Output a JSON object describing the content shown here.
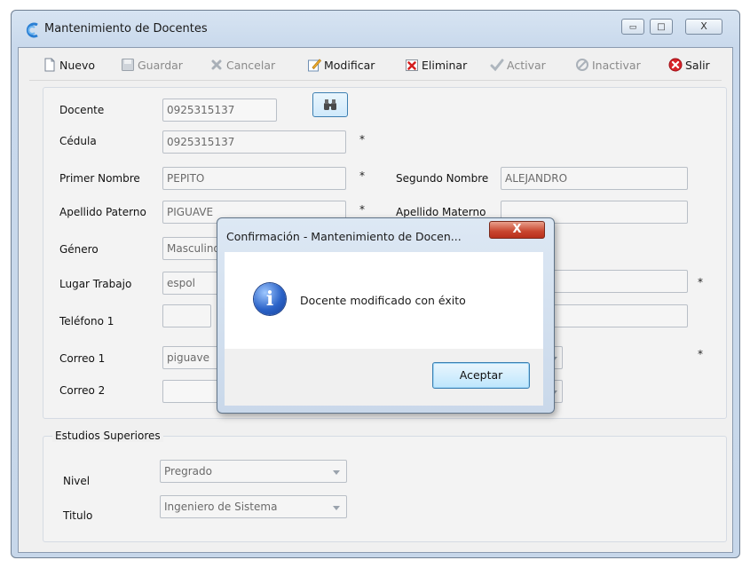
{
  "window": {
    "title": "Mantenimiento de Docentes",
    "minimize": "▭",
    "maximize": "□",
    "close": "X"
  },
  "toolbar": {
    "nuevo": "Nuevo",
    "guardar": "Guardar",
    "cancelar": "Cancelar",
    "modificar": "Modificar",
    "eliminar": "Eliminar",
    "activar": "Activar",
    "inactivar": "Inactivar",
    "salir": "Salir"
  },
  "form": {
    "docente_label": "Docente",
    "docente_value": "0925315137",
    "cedula_label": "Cédula",
    "cedula_value": "0925315137",
    "primer_nombre_label": "Primer Nombre",
    "primer_nombre_value": "PEPITO",
    "segundo_nombre_label": "Segundo Nombre",
    "segundo_nombre_value": "ALEJANDRO",
    "apellido_paterno_label": "Apellido Paterno",
    "apellido_paterno_value": "PIGUAVE",
    "apellido_materno_label": "Apellido Materno",
    "apellido_materno_value": "",
    "genero_label": "Género",
    "genero_value": "Masculino",
    "lugar_trabajo_label": "Lugar Trabajo",
    "lugar_trabajo_value": "espol",
    "telefono1_label": "Teléfono 1",
    "telefono1_value": "",
    "correo1_label": "Correo 1",
    "correo1_value": "piguave",
    "correo2_label": "Correo 2",
    "correo2_value": "",
    "required_mark": "*"
  },
  "estudios": {
    "legend": "Estudios Superiores",
    "nivel_label": "Nivel",
    "nivel_value": "Pregrado",
    "titulo_label": "Titulo",
    "titulo_value": "Ingeniero de Sistema"
  },
  "dialog": {
    "title": "Confirmación - Mantenimiento de Docen...",
    "close": "X",
    "message": "Docente modificado con éxito",
    "info_glyph": "i",
    "ok": "Aceptar"
  },
  "colors": {
    "accent": "#3c7fb1",
    "close_red": "#c8452e",
    "window_frame": "#c9d9ec"
  }
}
